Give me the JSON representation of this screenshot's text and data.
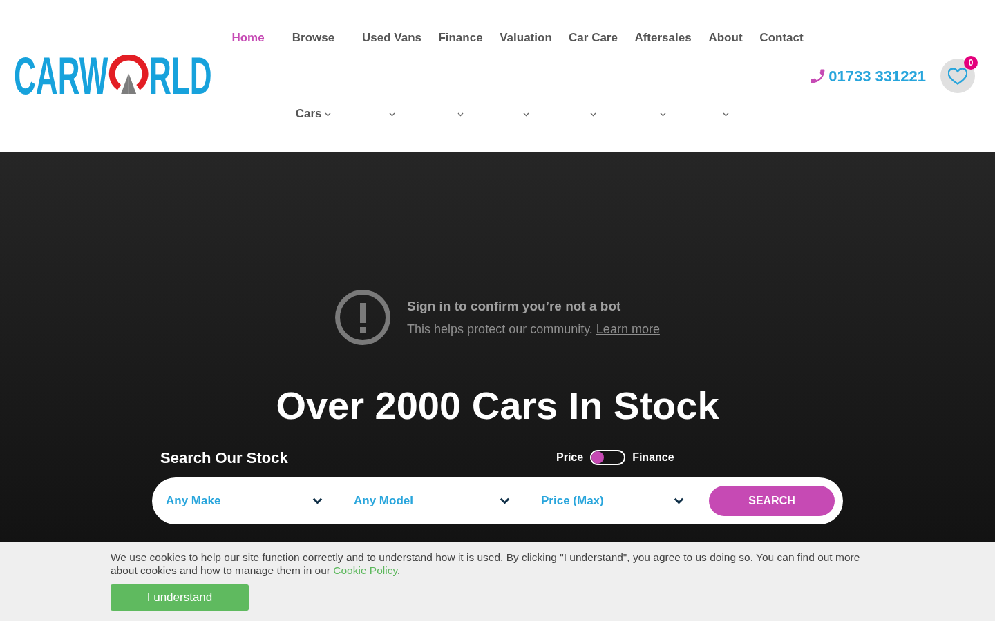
{
  "header": {
    "logo": {
      "left": "CARW",
      "right": "RLD"
    },
    "nav": [
      {
        "label": "Home",
        "selected": true,
        "has_menu": false
      },
      {
        "label": "Browse Cars",
        "selected": false,
        "has_menu": true
      },
      {
        "label": "Used Vans",
        "selected": false,
        "has_menu": true
      },
      {
        "label": "Finance",
        "selected": false,
        "has_menu": true
      },
      {
        "label": "Valuation",
        "selected": false,
        "has_menu": true
      },
      {
        "label": "Car Care",
        "selected": false,
        "has_menu": true
      },
      {
        "label": "Aftersales",
        "selected": false,
        "has_menu": true
      },
      {
        "label": "About",
        "selected": false,
        "has_menu": true
      },
      {
        "label": "Contact",
        "selected": false,
        "has_menu": false
      }
    ],
    "phone": "01733 331221",
    "favourites": {
      "count": "0"
    }
  },
  "hero": {
    "bot_notice": {
      "title": "Sign in to confirm you’re not a bot",
      "text": "This helps protect our community. ",
      "link": "Learn more"
    },
    "heading": "Over 2000 Cars In Stock",
    "search": {
      "title": "Search Our Stock",
      "toggle": {
        "left_label": "Price",
        "right_label": "Finance",
        "on": false
      },
      "dropdowns": [
        {
          "value": "Any Make"
        },
        {
          "value": "Any Model"
        },
        {
          "value": "Price (Max)"
        }
      ],
      "button": "SEARCH"
    }
  },
  "cookie_banner": {
    "text": "We use cookies to help our site function correctly and to understand how it is used. By clicking \"I understand\", you agree to us doing so. You can find out more about cookies and how to manage them in our ",
    "link": "Cookie Policy",
    "text_after": ".",
    "button": "I understand"
  }
}
